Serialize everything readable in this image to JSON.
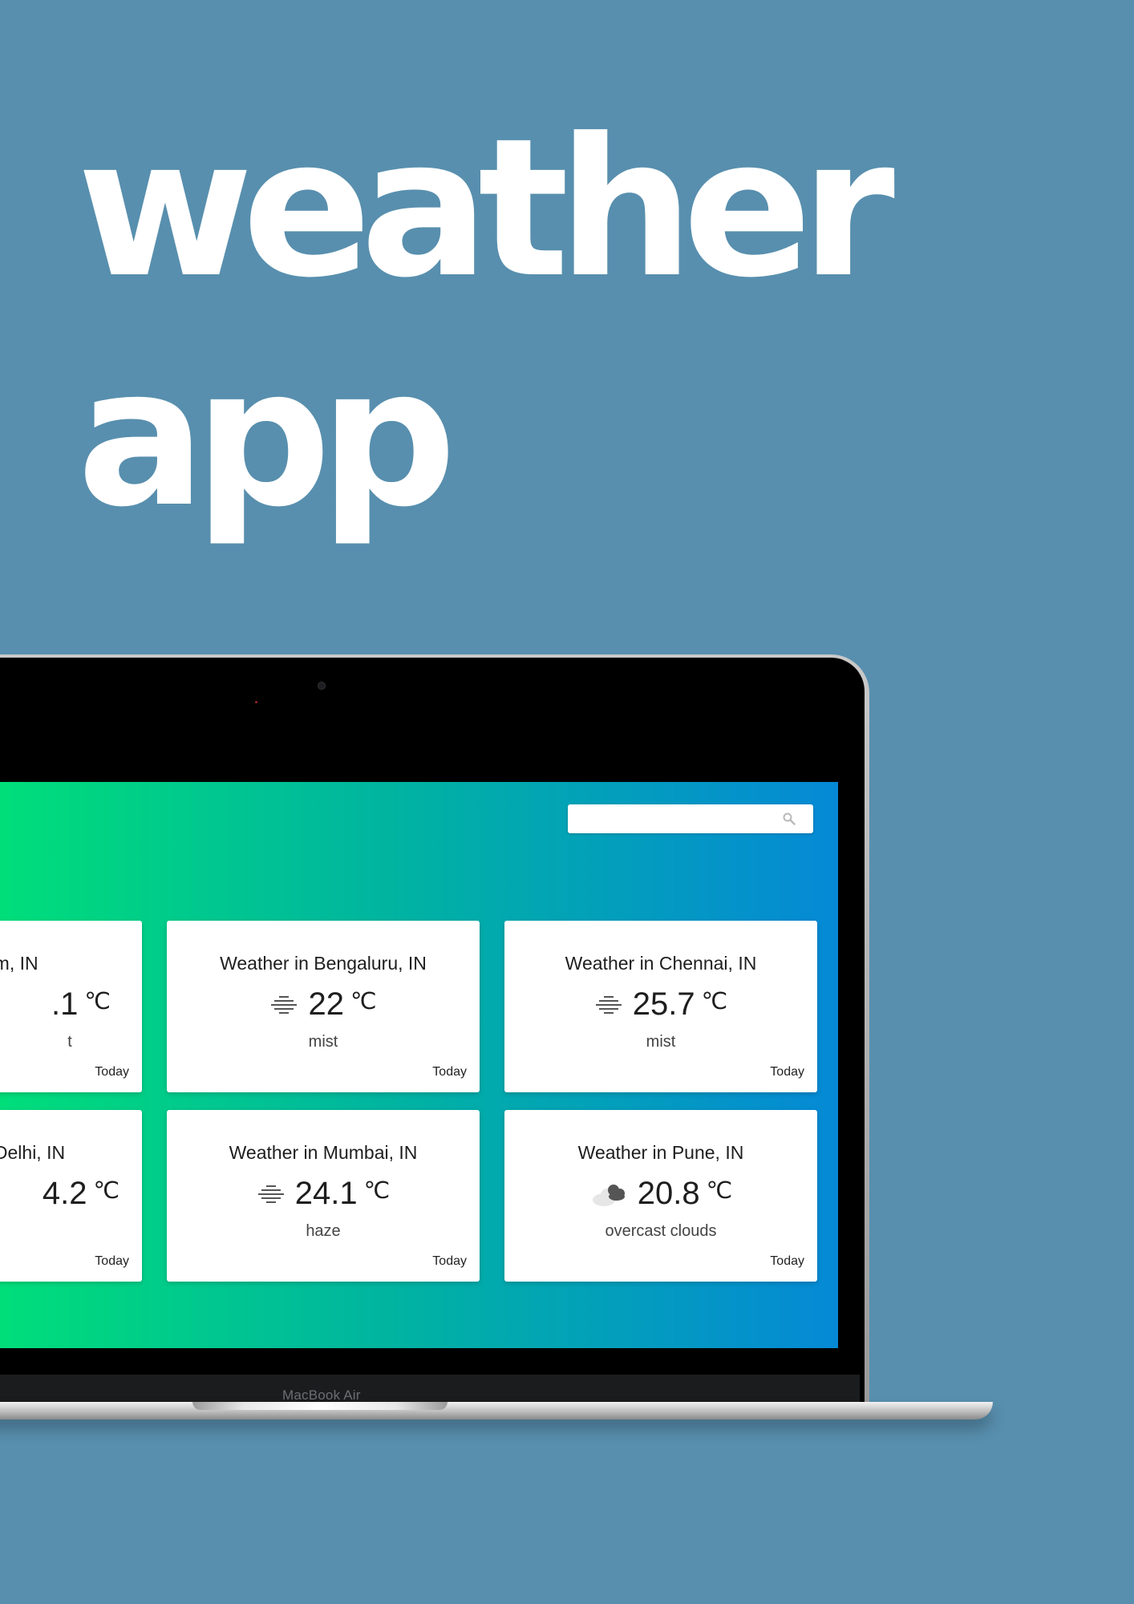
{
  "headline": {
    "line1": "weather",
    "line2": "app"
  },
  "laptop": {
    "model_label": "MacBook Air"
  },
  "search": {
    "value": "",
    "placeholder": ""
  },
  "cards": [
    {
      "title": "elgaum, IN",
      "temp": ".1",
      "unit": "℃",
      "condition": "t",
      "day": "Today",
      "icon": "mist-icon"
    },
    {
      "title": "Weather in Bengaluru, IN",
      "temp": "22",
      "unit": "℃",
      "condition": "mist",
      "day": "Today",
      "icon": "mist-icon"
    },
    {
      "title": "Weather in Chennai, IN",
      "temp": "25.7",
      "unit": "℃",
      "condition": "mist",
      "day": "Today",
      "icon": "mist-icon"
    },
    {
      "title": "Delhi, IN",
      "temp": "4.2",
      "unit": "℃",
      "condition": "",
      "day": "Today",
      "icon": "haze-icon"
    },
    {
      "title": "Weather in Mumbai, IN",
      "temp": "24.1",
      "unit": "℃",
      "condition": "haze",
      "day": "Today",
      "icon": "haze-icon"
    },
    {
      "title": "Weather in Pune, IN",
      "temp": "20.8",
      "unit": "℃",
      "condition": "overcast clouds",
      "day": "Today",
      "icon": "overcast-clouds-icon"
    }
  ],
  "colors": {
    "background": "#588fae",
    "gradient_start": "#00de7a",
    "gradient_end": "#0589d6",
    "card": "#ffffff"
  }
}
